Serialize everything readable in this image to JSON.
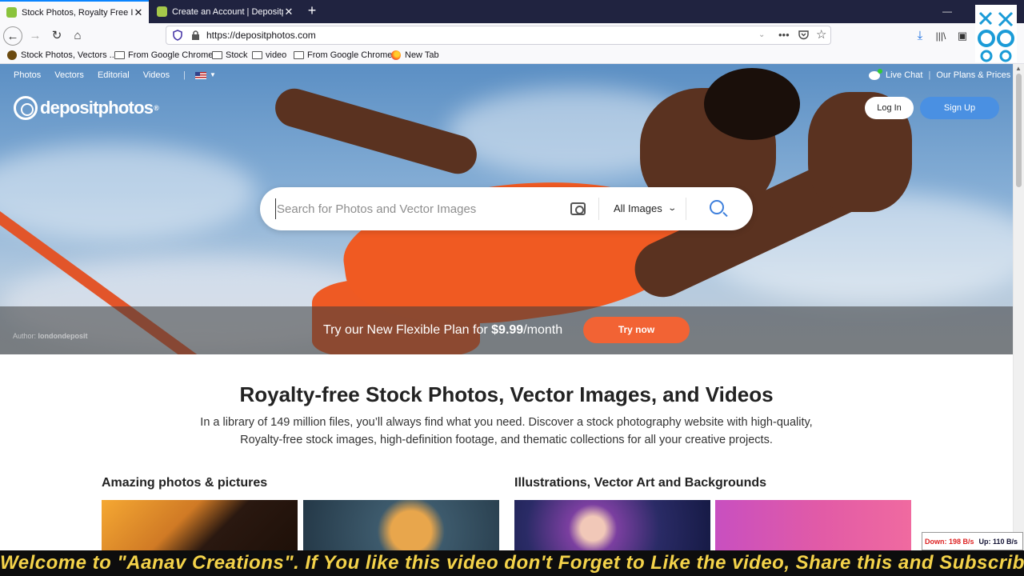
{
  "browser": {
    "tabs": [
      {
        "title": "Stock Photos, Royalty Free Imag",
        "active": true
      },
      {
        "title": "Create an Account | Depositph",
        "active": false
      }
    ],
    "new_tab_symbol": "+",
    "close_symbol": "✕",
    "url": "https://depositphotos.com",
    "url_icons": {
      "more": "•••",
      "pocket": "pocket-icon",
      "star": "☆"
    },
    "bookmarks": [
      {
        "label": "Stock Photos, Vectors ...",
        "icon": "site-icon"
      },
      {
        "label": "From Google Chrome",
        "icon": "folder-icon"
      },
      {
        "label": "Stock",
        "icon": "folder-icon"
      },
      {
        "label": "video",
        "icon": "folder-icon"
      },
      {
        "label": "From Google Chrome",
        "icon": "folder-icon"
      },
      {
        "label": "New Tab",
        "icon": "firefox-icon"
      }
    ]
  },
  "site": {
    "nav": [
      "Photos",
      "Vectors",
      "Editorial",
      "Videos"
    ],
    "nav_divider": "|",
    "logo_text": "depositphotos",
    "logo_reg": "®",
    "live_chat": "Live Chat",
    "header_divider": "|",
    "plans": "Our Plans & Prices",
    "login": "Log In",
    "signup": "Sign Up",
    "search": {
      "placeholder": "Search for Photos and Vector Images",
      "filter": "All Images"
    },
    "hero_author_label": "Author:",
    "hero_author": "londondeposit",
    "promo": {
      "prefix": "Try our New Flexible Plan for ",
      "price": "$9.99",
      "suffix": "/month",
      "button": "Try now"
    },
    "title": "Royalty-free Stock Photos, Vector Images, and Videos",
    "subtitle_line1": "In a library of 149 million files, you’ll always find what you need. Discover a stock photography website with high-quality,",
    "subtitle_line2": "Royalty-free stock images, high-definition footage, and thematic collections for all your creative projects.",
    "sections": [
      {
        "title": "Amazing photos & pictures"
      },
      {
        "title": "Illustrations, Vector Art and Backgrounds"
      }
    ]
  },
  "overlay": {
    "net_down": "Down: 198 B/s",
    "net_up": "Up: 110 B/s",
    "ticker": "Welcome to \"Aanav Creations\". If You like this video don't Forget to Like the video, Share this and Subscribe our C"
  },
  "colors": {
    "accent_blue": "#4a90e2",
    "promo_orange": "#f26334",
    "ticker_yellow": "#f4d34a"
  }
}
